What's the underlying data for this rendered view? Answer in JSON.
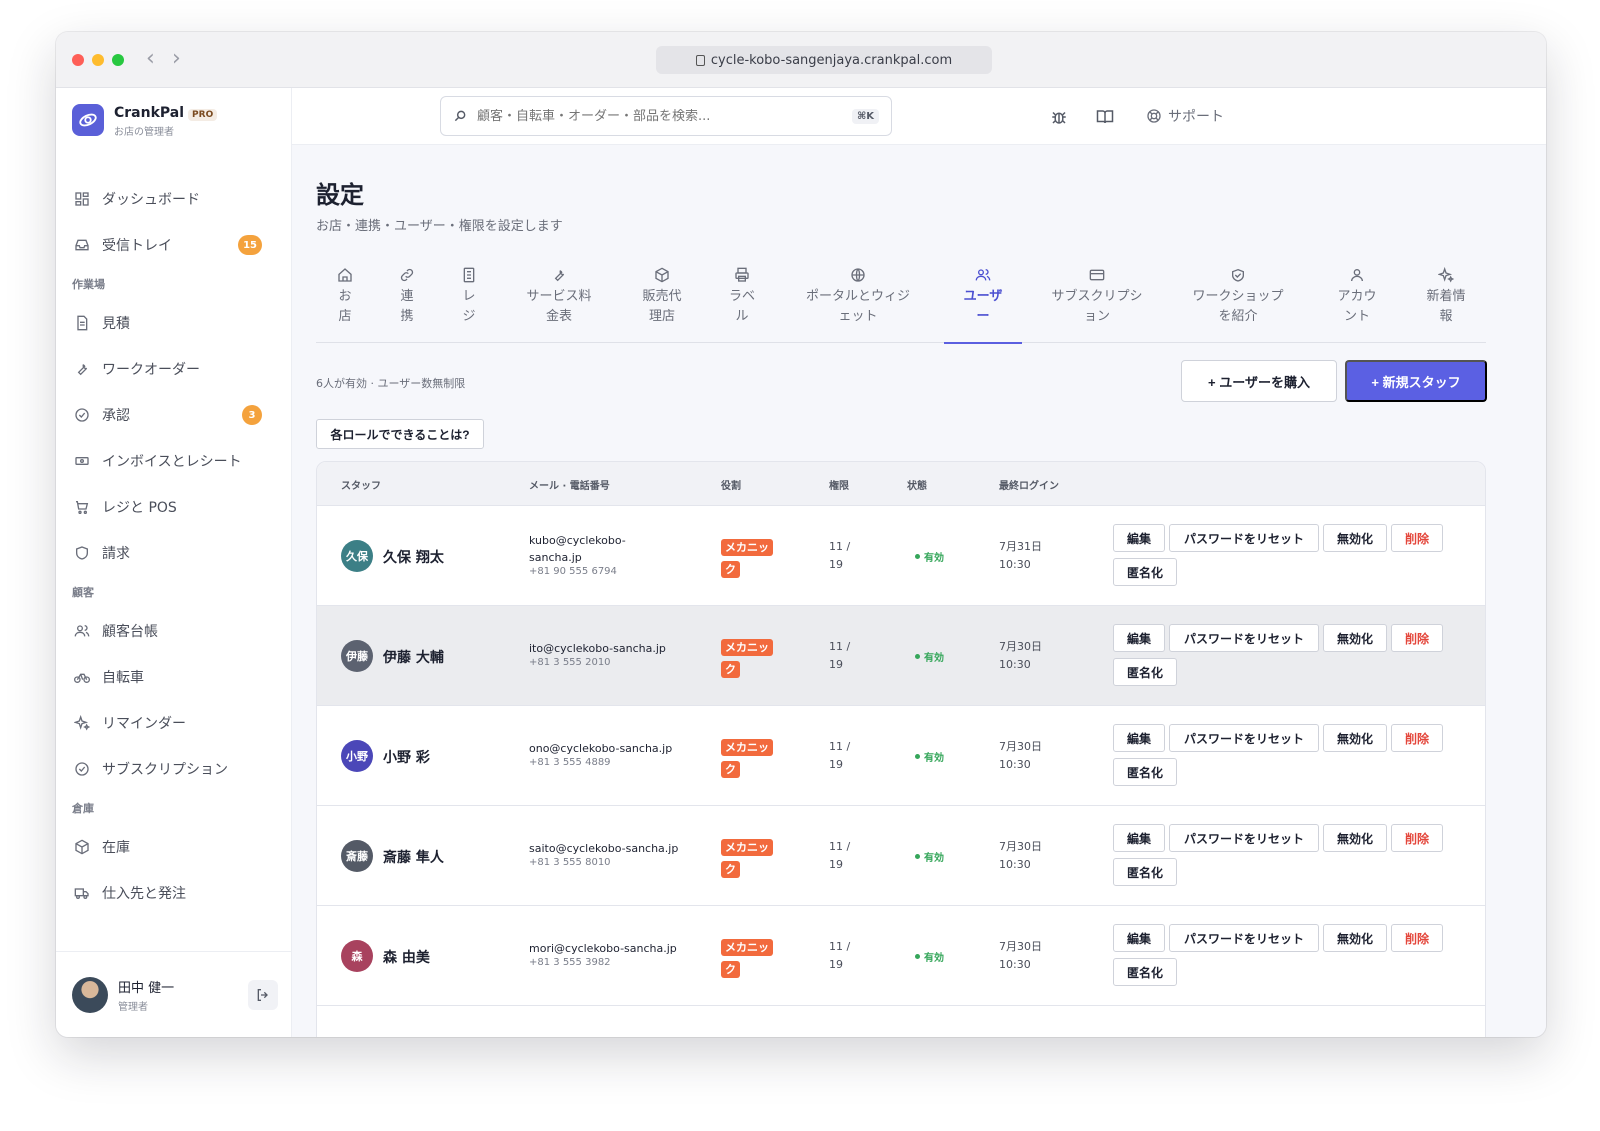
{
  "browser": {
    "url": "cycle-kobo-sangenjaya.crankpal.com"
  },
  "brand": {
    "name": "CrankPal",
    "badge": "PRO",
    "subtitle": "お店の管理者"
  },
  "topbar": {
    "search_placeholder": "顧客・自転車・オーダー・部品を検索...",
    "shortcut": "⌘K",
    "support_label": "サポート"
  },
  "sidebar": {
    "items": [
      {
        "label": "ダッシュボード",
        "icon": "dashboard-icon"
      },
      {
        "label": "受信トレイ",
        "icon": "inbox-icon",
        "badge": "15"
      },
      {
        "section": "作業場"
      },
      {
        "label": "見積",
        "icon": "document-icon"
      },
      {
        "label": "ワークオーダー",
        "icon": "wrench-icon"
      },
      {
        "label": "承認",
        "icon": "check-circle-icon",
        "badge": "3"
      },
      {
        "label": "インボイスとレシート",
        "icon": "receipt-icon"
      },
      {
        "label": "レジと POS",
        "icon": "cart-icon"
      },
      {
        "label": "請求",
        "icon": "shield-icon"
      },
      {
        "section": "顧客"
      },
      {
        "label": "顧客台帳",
        "icon": "users-icon"
      },
      {
        "label": "自転車",
        "icon": "bicycle-icon"
      },
      {
        "label": "リマインダー",
        "icon": "sparkle-icon"
      },
      {
        "label": "サブスクリプション",
        "icon": "check-circle-icon"
      },
      {
        "section": "倉庫"
      },
      {
        "label": "在庫",
        "icon": "box-icon"
      },
      {
        "label": "仕入先と発注",
        "icon": "truck-icon"
      }
    ],
    "user": {
      "name": "田中 健一",
      "role": "管理者"
    }
  },
  "page": {
    "title": "設定",
    "subtitle": "お店・連携・ユーザー・権限を設定します"
  },
  "tabs": [
    {
      "label": "お\n店",
      "icon": "home-icon"
    },
    {
      "label": "連\n携",
      "icon": "link-icon"
    },
    {
      "label": "レ\nジ",
      "icon": "register-icon"
    },
    {
      "label": "サービス料\n金表",
      "icon": "wrench-icon"
    },
    {
      "label": "販売代\n理店",
      "icon": "box-icon"
    },
    {
      "label": "ラベ\nル",
      "icon": "printer-icon"
    },
    {
      "label": "ポータルとウィジ\nェット",
      "icon": "globe-icon"
    },
    {
      "label": "ユーザ\nー",
      "icon": "users-icon",
      "active": true
    },
    {
      "label": "サブスクリプシ\nョン",
      "icon": "card-icon"
    },
    {
      "label": "ワークショップ\nを紹介",
      "icon": "handshake-icon"
    },
    {
      "label": "アカウ\nント",
      "icon": "user-icon"
    },
    {
      "label": "新着情\n報",
      "icon": "sparkle-icon"
    }
  ],
  "users_panel": {
    "count_note": "6人が有効 · ユーザー数無制限",
    "buy_button": "+ ユーザーを購入",
    "new_button": "+ 新規スタッフ",
    "roles_button": "各ロールでできることは?"
  },
  "table": {
    "headers": {
      "staff": "スタッフ",
      "contact": "メール · 電話番号",
      "role": "役割",
      "perm": "権限",
      "status": "状態",
      "last_login": "最終ログイン"
    },
    "actions": {
      "edit": "編集",
      "reset": "パスワードをリセット",
      "disable": "無効化",
      "delete": "削除",
      "anonymize": "匿名化"
    },
    "rows": [
      {
        "initials": "久保",
        "name": "久保 翔太",
        "email": "kubo@cyclekobo-sancha.jp",
        "phone": "+81 90 555 6794",
        "role": "メカニック",
        "perm": "11 / 19",
        "status": "有効",
        "login": "7月31日\n10:30",
        "color": "#3c7f86"
      },
      {
        "initials": "伊藤",
        "name": "伊藤 大輔",
        "email": "ito@cyclekobo-sancha.jp",
        "phone": "+81 3 555 2010",
        "role": "メカニック",
        "perm": "11 / 19",
        "status": "有効",
        "login": "7月30日\n10:30",
        "color": "#5c6270"
      },
      {
        "initials": "小野",
        "name": "小野 彩",
        "email": "ono@cyclekobo-sancha.jp",
        "phone": "+81 3 555 4889",
        "role": "メカニック",
        "perm": "11 / 19",
        "status": "有効",
        "login": "7月30日\n10:30",
        "color": "#4b47b8"
      },
      {
        "initials": "斎藤",
        "name": "斎藤 隼人",
        "email": "saito@cyclekobo-sancha.jp",
        "phone": "+81 3 555 8010",
        "role": "メカニック",
        "perm": "11 / 19",
        "status": "有効",
        "login": "7月30日\n10:30",
        "color": "#545a66"
      },
      {
        "initials": "森",
        "name": "森 由美",
        "email": "mori@cyclekobo-sancha.jp",
        "phone": "+81 3 555 3982",
        "role": "メカニック",
        "perm": "11 / 19",
        "status": "有効",
        "login": "7月30日\n10:30",
        "color": "#a8425e"
      }
    ]
  },
  "colors": {
    "accent": "#5b60e3",
    "role_tag": "#f26a3d",
    "status_active": "#35a65a",
    "danger": "#e4463b",
    "badge": "#f4a23d"
  }
}
